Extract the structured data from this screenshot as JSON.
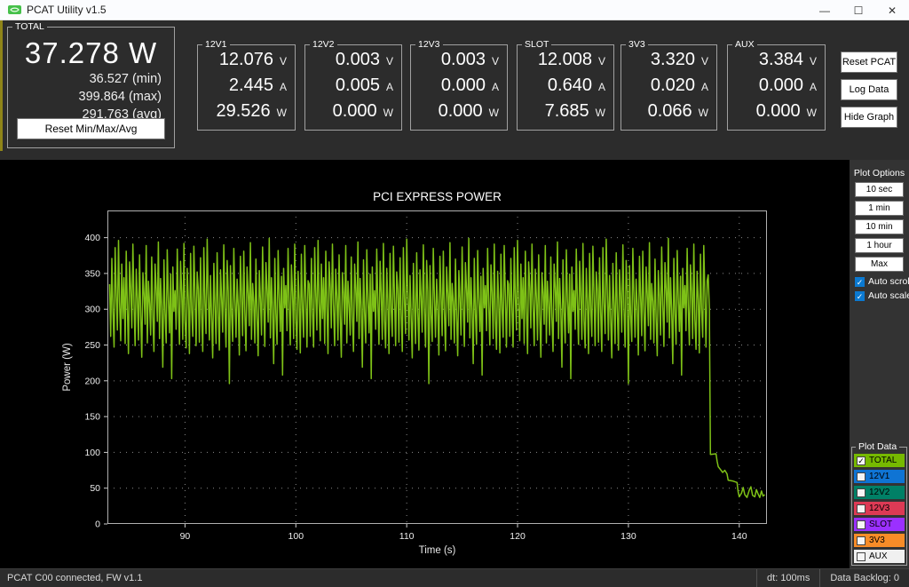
{
  "titlebar": {
    "title": "PCAT Utility v1.5",
    "minimize": "—",
    "maximize": "☐",
    "close": "✕"
  },
  "total": {
    "label": "TOTAL",
    "value": "37.278 W",
    "min": "36.527 (min)",
    "max": "399.864 (max)",
    "avg": "291.763 (avg)",
    "reset_label": "Reset Min/Max/Avg"
  },
  "units": {
    "v": "V",
    "a": "A",
    "w": "W"
  },
  "rails": [
    {
      "label": "12V1",
      "v": "12.076",
      "a": "2.445",
      "w": "29.526"
    },
    {
      "label": "12V2",
      "v": "0.003",
      "a": "0.005",
      "w": "0.000"
    },
    {
      "label": "12V3",
      "v": "0.003",
      "a": "0.000",
      "w": "0.000"
    },
    {
      "label": "SLOT",
      "v": "12.008",
      "a": "0.640",
      "w": "7.685"
    },
    {
      "label": "3V3",
      "v": "3.320",
      "a": "0.020",
      "w": "0.066"
    },
    {
      "label": "AUX",
      "v": "3.384",
      "a": "0.000",
      "w": "0.000"
    }
  ],
  "actions": [
    "Reset PCAT",
    "Log Data",
    "Hide Graph"
  ],
  "plot_options": {
    "label": "Plot Options",
    "buttons": [
      "10 sec",
      "1 min",
      "10 min",
      "1 hour",
      "Max"
    ],
    "checkboxes": [
      {
        "label": "Auto scroll",
        "checked": true
      },
      {
        "label": "Auto scale",
        "checked": true
      }
    ],
    "check_glyph": "✓"
  },
  "plot_data": {
    "label": "Plot Data",
    "items": [
      {
        "label": "TOTAL",
        "color": "#76b900",
        "checked": true
      },
      {
        "label": "12V1",
        "color": "#0f74d4",
        "checked": false
      },
      {
        "label": "12V2",
        "color": "#008066",
        "checked": false
      },
      {
        "label": "12V3",
        "color": "#dc3a55",
        "checked": false
      },
      {
        "label": "SLOT",
        "color": "#9b30ff",
        "checked": false
      },
      {
        "label": "3V3",
        "color": "#f78c28",
        "checked": false
      },
      {
        "label": "AUX",
        "color": "#f0f0f0",
        "checked": false
      }
    ]
  },
  "status_bar": {
    "left": "PCAT C00 connected, FW v1.1",
    "dt": "dt: 100ms",
    "backlog": "Data Backlog: 0"
  },
  "chart_data": {
    "type": "line",
    "title": "PCI EXPRESS POWER",
    "xlabel": "Time (s)",
    "ylabel": "Power (W)",
    "xlim": [
      83.0,
      142.5
    ],
    "ylim": [
      0,
      438
    ],
    "x_ticks": [
      90,
      100,
      110,
      120,
      130,
      140
    ],
    "y_ticks": [
      0,
      50,
      100,
      150,
      200,
      250,
      300,
      350,
      400
    ],
    "grid": true,
    "line_color": "#7ec117",
    "series_name": "TOTAL",
    "noise": {
      "t_start": 83.2,
      "dt": 0.1,
      "repeat": 3,
      "pattern": [
        335,
        262,
        371,
        298,
        247,
        386,
        318,
        271,
        396,
        309,
        256,
        363,
        287,
        344,
        252,
        381,
        301,
        238,
        366,
        331,
        274,
        391,
        306,
        249,
        356,
        316,
        257,
        376,
        292,
        233,
        351,
        322,
        279,
        389,
        253,
        339,
        307,
        264,
        373,
        289,
        241,
        363,
        329,
        283,
        394,
        259,
        343,
        301,
        219,
        369,
        296,
        253,
        383,
        313,
        267,
        349,
        203,
        359,
        297,
        326,
        272,
        384,
        308,
        251,
        367,
        323,
        258,
        392,
        284,
        246,
        357,
        312,
        238,
        378,
        299,
        262,
        388,
        317,
        249,
        352,
        328,
        254,
        372,
        295,
        241,
        386,
        309,
        266,
        398,
        321,
        257,
        347,
        288,
        232,
        364,
        306,
        252,
        379,
        298,
        243,
        355,
        317,
        268,
        390,
        302,
        247,
        368,
        325,
        196,
        361,
        293,
        255,
        385,
        314,
        261,
        342,
        304,
        236,
        374,
        319,
        263,
        381,
        297,
        242,
        359,
        322,
        277,
        393,
        258,
        336,
        311,
        253,
        370,
        289,
        235,
        354,
        316,
        264,
        387,
        307,
        248,
        365,
        327,
        282,
        399,
        260,
        344,
        299,
        224,
        371,
        294,
        251,
        382,
        315,
        269,
        346,
        208,
        357,
        302,
        333,
        270,
        385,
        305,
        250,
        362,
        324,
        259,
        391,
        286,
        244,
        353,
        313,
        239,
        377,
        300,
        261,
        389,
        318,
        247,
        340
      ]
    },
    "tail": [
      [
        137.2,
        348
      ],
      [
        137.3,
        300
      ],
      [
        137.4,
        97
      ],
      [
        137.9,
        98
      ],
      [
        138.0,
        88
      ],
      [
        138.1,
        80
      ],
      [
        138.3,
        76
      ],
      [
        138.5,
        72
      ],
      [
        138.7,
        75
      ],
      [
        138.9,
        70
      ],
      [
        139.0,
        61
      ],
      [
        139.4,
        60
      ],
      [
        139.8,
        58
      ],
      [
        139.9,
        45
      ],
      [
        140.0,
        38
      ],
      [
        140.2,
        43
      ],
      [
        140.35,
        51
      ],
      [
        140.5,
        41
      ],
      [
        140.7,
        37
      ],
      [
        140.9,
        47
      ],
      [
        141.05,
        52
      ],
      [
        141.2,
        40
      ],
      [
        141.4,
        38
      ],
      [
        141.55,
        48
      ],
      [
        141.7,
        42
      ],
      [
        141.85,
        37
      ],
      [
        142.0,
        46
      ],
      [
        142.15,
        39
      ],
      [
        142.3,
        41
      ]
    ]
  },
  "colors": {
    "panel_bg": "#2c2c2c",
    "sidebar_bg": "#333333",
    "chart_bg": "#000000",
    "accent_check_blue": "#0b79d0",
    "titlebar_bg": "#fbfcfe"
  }
}
